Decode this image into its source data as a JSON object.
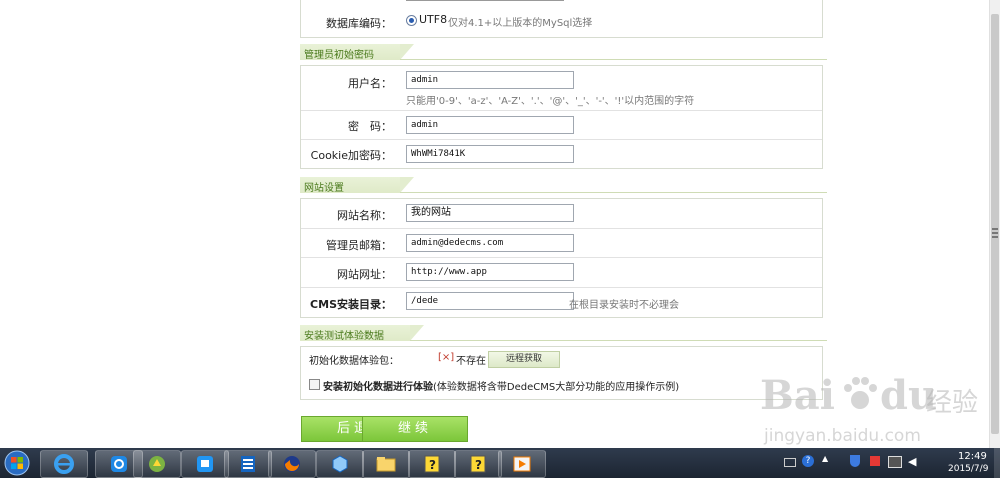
{
  "db": {
    "encoding_label": "数据库编码：",
    "encoding_value": "UTF8",
    "encoding_hint": "仅对4.1+以上版本的MySql选择"
  },
  "admin_section": {
    "title": "管理员初始密码",
    "username_label": "用户名：",
    "username_value": "admin",
    "username_hint": "只能用'0-9'、'a-z'、'A-Z'、'.'、'@'、'_'、'-'、'!'以内范围的字符",
    "password_label": "密　码：",
    "password_value": "admin",
    "cookie_label": "Cookie加密码：",
    "cookie_value": "WhWMi7841K"
  },
  "site_section": {
    "title": "网站设置",
    "name_label": "网站名称：",
    "name_value": "我的网站",
    "email_label": "管理员邮箱：",
    "email_value": "admin@dedecms.com",
    "url_label": "网站网址：",
    "url_value": "http://www.app",
    "dir_label": "CMS安装目录：",
    "dir_value": "/dede",
    "dir_hint": "在根目录安装时不必理会"
  },
  "test_section": {
    "title": "安装测试体验数据",
    "init_label": "初始化数据体验包：",
    "status_mark": "[×]",
    "status_text": "不存在",
    "remote_button": "远程获取",
    "checkbox_label_bold": "安装初始化数据进行体验",
    "checkbox_label_rest": "(体验数据将含带DedeCMS大部分功能的应用操作示例)"
  },
  "buttons": {
    "back": "后退",
    "next": "继续"
  },
  "taskbar": {
    "time": "12:49",
    "date": "2015/7/9"
  },
  "watermark": {
    "brand": "Bai",
    "brand_cn": "经验",
    "url": "jingyan.baidu.com"
  },
  "colors": {
    "accent_green": "#7cc63a",
    "section_title": "#4a7a1c",
    "error_red": "#c0392b"
  }
}
